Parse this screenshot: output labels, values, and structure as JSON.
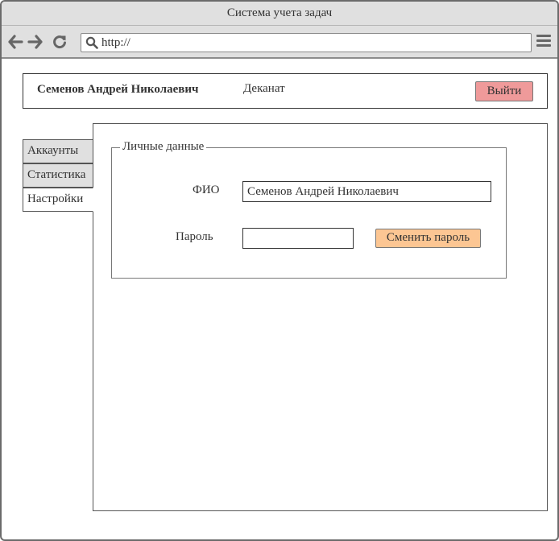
{
  "window": {
    "title": "Система учета задач"
  },
  "browser": {
    "address": {
      "value": "http://",
      "placeholder": ""
    },
    "icons": {
      "back": "arrow-left-icon",
      "forward": "arrow-right-icon",
      "reload": "reload-icon",
      "search": "search-icon",
      "menu": "hamburger-menu-icon"
    }
  },
  "header": {
    "user_name": "Семенов Андрей Николаевич",
    "department": "Деканат",
    "logout_label": "Выйти"
  },
  "tabs": [
    {
      "label": "Аккаунты",
      "active": false
    },
    {
      "label": "Статистика",
      "active": false
    },
    {
      "label": "Настройки",
      "active": true
    }
  ],
  "personal_data": {
    "legend": "Личные данные",
    "fio_label": "ФИО",
    "fio_value": "Семенов Андрей Николаевич",
    "password_label": "Пароль",
    "password_value": "",
    "change_password_label": "Сменить пароль"
  },
  "colors": {
    "logout_button": "#ef9a9a",
    "change_password_button": "#fcc693",
    "chrome_background": "#e0e0e0"
  }
}
